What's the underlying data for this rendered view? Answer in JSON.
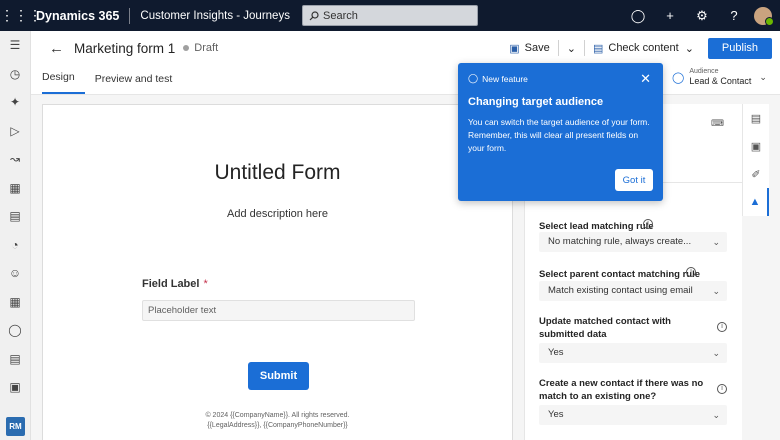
{
  "topbar": {
    "brand": "Dynamics 365",
    "app_name": "Customer Insights - Journeys",
    "search_placeholder": "Search",
    "avatar": "user"
  },
  "leftnav": {
    "icons": [
      "menu-icon",
      "recent-icon",
      "pin-icon",
      "play-icon",
      "journeys-icon",
      "building-icon",
      "forms-icon",
      "segments-icon",
      "contacts-icon",
      "leads-icon",
      "analytics-icon",
      "documents-icon",
      "assets-icon"
    ],
    "user_initials": "RM"
  },
  "command_bar": {
    "title": "Marketing form 1",
    "status": "Draft",
    "save_label": "Save",
    "check_content_label": "Check content",
    "publish_label": "Publish"
  },
  "tabs": [
    {
      "label": "Design",
      "active": true
    },
    {
      "label": "Preview and test",
      "active": false
    }
  ],
  "audience": {
    "caption": "Audience",
    "value": "Lead & Contact"
  },
  "form": {
    "title": "Untitled Form",
    "description": "Add description here",
    "field_label": "Field Label",
    "required_mark": "*",
    "field_placeholder": "Placeholder text",
    "submit_label": "Submit",
    "footer_line1": "© 2024 {{CompanyName}}. All rights reserved.",
    "footer_line2": "{{LegalAddress}}, {{CompanyPhoneNumber}}"
  },
  "right_panel": {
    "lead_rule_label": "Select lead matching rule",
    "lead_rule_value": "No matching rule, always create...",
    "contact_rule_label": "Select parent contact matching rule",
    "contact_rule_value": "Match existing contact using email",
    "update_contact_label": "Update matched contact with submitted data",
    "update_contact_value": "Yes",
    "create_contact_label": "Create a new contact if there was no match to an existing one?",
    "create_contact_value": "Yes"
  },
  "popup": {
    "badge": "New feature",
    "heading": "Changing target audience",
    "body": "You can switch the target audience of your form. Remember, this will clear all present fields on your form.",
    "button_label": "Got it"
  },
  "colors": {
    "topbar_bg": "#0f1a2e",
    "accent": "#1b6ed6",
    "required": "#c4314b"
  }
}
